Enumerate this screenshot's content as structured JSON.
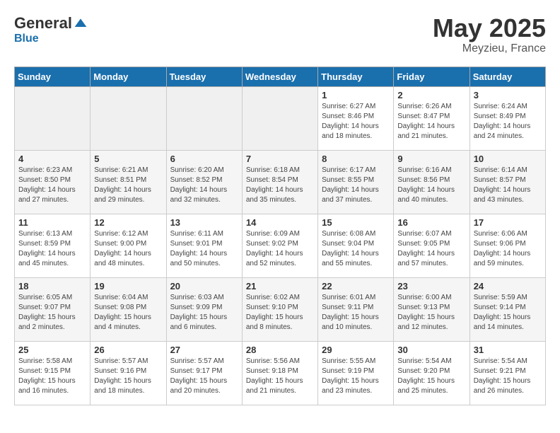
{
  "header": {
    "logo_general": "General",
    "logo_blue": "Blue",
    "month": "May 2025",
    "location": "Meyzieu, France"
  },
  "weekdays": [
    "Sunday",
    "Monday",
    "Tuesday",
    "Wednesday",
    "Thursday",
    "Friday",
    "Saturday"
  ],
  "weeks": [
    [
      {
        "day": "",
        "empty": true
      },
      {
        "day": "",
        "empty": true
      },
      {
        "day": "",
        "empty": true
      },
      {
        "day": "",
        "empty": true
      },
      {
        "day": "1",
        "sunrise": "6:27 AM",
        "sunset": "8:46 PM",
        "daylight": "14 hours and 18 minutes."
      },
      {
        "day": "2",
        "sunrise": "6:26 AM",
        "sunset": "8:47 PM",
        "daylight": "14 hours and 21 minutes."
      },
      {
        "day": "3",
        "sunrise": "6:24 AM",
        "sunset": "8:49 PM",
        "daylight": "14 hours and 24 minutes."
      }
    ],
    [
      {
        "day": "4",
        "sunrise": "6:23 AM",
        "sunset": "8:50 PM",
        "daylight": "14 hours and 27 minutes."
      },
      {
        "day": "5",
        "sunrise": "6:21 AM",
        "sunset": "8:51 PM",
        "daylight": "14 hours and 29 minutes."
      },
      {
        "day": "6",
        "sunrise": "6:20 AM",
        "sunset": "8:52 PM",
        "daylight": "14 hours and 32 minutes."
      },
      {
        "day": "7",
        "sunrise": "6:18 AM",
        "sunset": "8:54 PM",
        "daylight": "14 hours and 35 minutes."
      },
      {
        "day": "8",
        "sunrise": "6:17 AM",
        "sunset": "8:55 PM",
        "daylight": "14 hours and 37 minutes."
      },
      {
        "day": "9",
        "sunrise": "6:16 AM",
        "sunset": "8:56 PM",
        "daylight": "14 hours and 40 minutes."
      },
      {
        "day": "10",
        "sunrise": "6:14 AM",
        "sunset": "8:57 PM",
        "daylight": "14 hours and 43 minutes."
      }
    ],
    [
      {
        "day": "11",
        "sunrise": "6:13 AM",
        "sunset": "8:59 PM",
        "daylight": "14 hours and 45 minutes."
      },
      {
        "day": "12",
        "sunrise": "6:12 AM",
        "sunset": "9:00 PM",
        "daylight": "14 hours and 48 minutes."
      },
      {
        "day": "13",
        "sunrise": "6:11 AM",
        "sunset": "9:01 PM",
        "daylight": "14 hours and 50 minutes."
      },
      {
        "day": "14",
        "sunrise": "6:09 AM",
        "sunset": "9:02 PM",
        "daylight": "14 hours and 52 minutes."
      },
      {
        "day": "15",
        "sunrise": "6:08 AM",
        "sunset": "9:04 PM",
        "daylight": "14 hours and 55 minutes."
      },
      {
        "day": "16",
        "sunrise": "6:07 AM",
        "sunset": "9:05 PM",
        "daylight": "14 hours and 57 minutes."
      },
      {
        "day": "17",
        "sunrise": "6:06 AM",
        "sunset": "9:06 PM",
        "daylight": "14 hours and 59 minutes."
      }
    ],
    [
      {
        "day": "18",
        "sunrise": "6:05 AM",
        "sunset": "9:07 PM",
        "daylight": "15 hours and 2 minutes."
      },
      {
        "day": "19",
        "sunrise": "6:04 AM",
        "sunset": "9:08 PM",
        "daylight": "15 hours and 4 minutes."
      },
      {
        "day": "20",
        "sunrise": "6:03 AM",
        "sunset": "9:09 PM",
        "daylight": "15 hours and 6 minutes."
      },
      {
        "day": "21",
        "sunrise": "6:02 AM",
        "sunset": "9:10 PM",
        "daylight": "15 hours and 8 minutes."
      },
      {
        "day": "22",
        "sunrise": "6:01 AM",
        "sunset": "9:11 PM",
        "daylight": "15 hours and 10 minutes."
      },
      {
        "day": "23",
        "sunrise": "6:00 AM",
        "sunset": "9:13 PM",
        "daylight": "15 hours and 12 minutes."
      },
      {
        "day": "24",
        "sunrise": "5:59 AM",
        "sunset": "9:14 PM",
        "daylight": "15 hours and 14 minutes."
      }
    ],
    [
      {
        "day": "25",
        "sunrise": "5:58 AM",
        "sunset": "9:15 PM",
        "daylight": "15 hours and 16 minutes."
      },
      {
        "day": "26",
        "sunrise": "5:57 AM",
        "sunset": "9:16 PM",
        "daylight": "15 hours and 18 minutes."
      },
      {
        "day": "27",
        "sunrise": "5:57 AM",
        "sunset": "9:17 PM",
        "daylight": "15 hours and 20 minutes."
      },
      {
        "day": "28",
        "sunrise": "5:56 AM",
        "sunset": "9:18 PM",
        "daylight": "15 hours and 21 minutes."
      },
      {
        "day": "29",
        "sunrise": "5:55 AM",
        "sunset": "9:19 PM",
        "daylight": "15 hours and 23 minutes."
      },
      {
        "day": "30",
        "sunrise": "5:54 AM",
        "sunset": "9:20 PM",
        "daylight": "15 hours and 25 minutes."
      },
      {
        "day": "31",
        "sunrise": "5:54 AM",
        "sunset": "9:21 PM",
        "daylight": "15 hours and 26 minutes."
      }
    ]
  ]
}
